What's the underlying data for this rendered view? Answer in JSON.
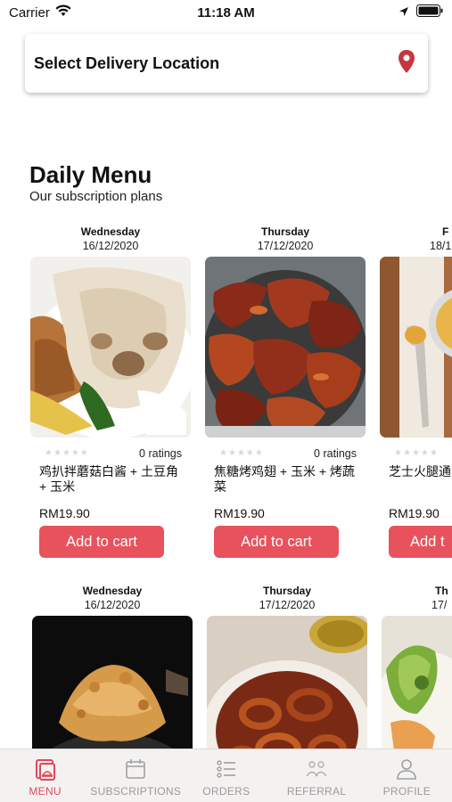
{
  "status_bar": {
    "carrier": "Carrier",
    "time": "11:18 AM"
  },
  "location": {
    "label": "Select Delivery Location",
    "icon": "location-pin-icon",
    "icon_color": "#c7363f"
  },
  "daily_menu": {
    "title": "Daily Menu",
    "subtitle": "Our subscription plans",
    "accent_color": "#e8525d",
    "row1": [
      {
        "day": "Wednesday",
        "date": "16/12/2020",
        "ratings": "0 ratings",
        "name": "鸡扒拌蘑菇白酱 + 土豆角 + 玉米",
        "price": "RM19.90",
        "button": "Add to cart"
      },
      {
        "day": "Thursday",
        "date": "17/12/2020",
        "ratings": "0 ratings",
        "name": "焦糖烤鸡翅 + 玉米 + 烤蔬菜",
        "price": "RM19.90",
        "button": "Add to cart"
      },
      {
        "day": "F",
        "date": "18/1",
        "ratings": "",
        "name": "芝士火腿通",
        "price": "RM19.90",
        "button": "Add t"
      }
    ],
    "row2": [
      {
        "day": "Wednesday",
        "date": "16/12/2020"
      },
      {
        "day": "Thursday",
        "date": "17/12/2020"
      },
      {
        "day": "Th",
        "date": "17/"
      }
    ]
  },
  "tab_bar": {
    "active_color": "#e0485a",
    "tabs": [
      {
        "label": "MENU",
        "icon": "menu-icon",
        "active": true
      },
      {
        "label": "SUBSCRIPTIONS",
        "icon": "calendar-icon",
        "active": false
      },
      {
        "label": "ORDERS",
        "icon": "list-icon",
        "active": false
      },
      {
        "label": "REFERRAL",
        "icon": "people-icon",
        "active": false
      },
      {
        "label": "PROFILE",
        "icon": "user-icon",
        "active": false
      }
    ]
  }
}
